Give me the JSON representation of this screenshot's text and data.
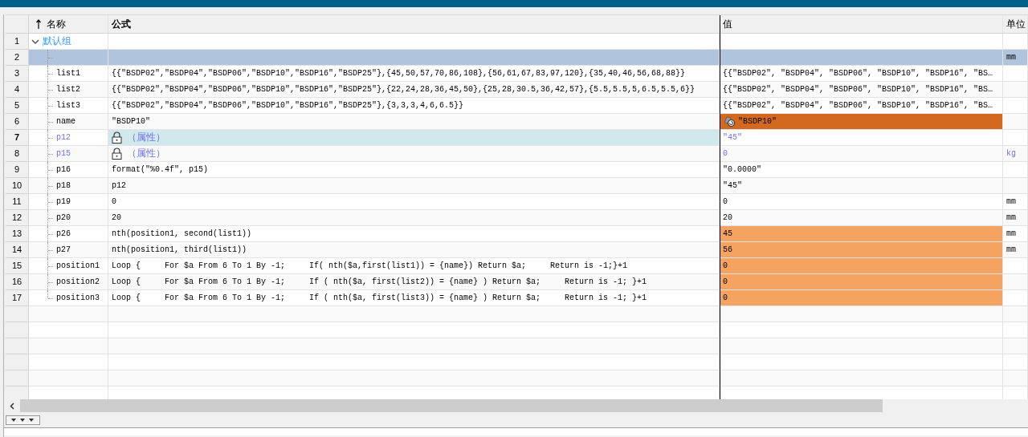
{
  "columns": [
    {
      "label": "名称",
      "sorted": true
    },
    {
      "label": "公式",
      "sorted": false
    },
    {
      "label": "值",
      "sorted": false
    },
    {
      "label": "单位",
      "sorted": false
    }
  ],
  "group": {
    "number": "1",
    "label": "默认组",
    "expanded": true,
    "rows": [
      {
        "number": "2",
        "selected": true,
        "current": false,
        "locked": false,
        "linked": false,
        "unit": "mm"
      },
      {
        "number": "3",
        "name": "list1",
        "formula": "{{\"BSDP02\",\"BSDP04\",\"BSDP06\",\"BSDP10\",\"BSDP16\",\"BSDP25\"},{45,50,57,70,86,108},{56,61,67,83,97,120},{35,40,46,56,68,88}}",
        "value": "{{\"BSDP02\", \"BSDP04\", \"BSDP06\", \"BSDP10\", \"BSDP16\", \"BS…",
        "selected": false,
        "current": false,
        "locked": false,
        "linked": false
      },
      {
        "number": "4",
        "name": "list2",
        "formula": "{{\"BSDP02\",\"BSDP04\",\"BSDP06\",\"BSDP10\",\"BSDP16\",\"BSDP25\"},{22,24,28,36,45,50},{25,28,30.5,36,42,57},{5.5,5.5,5,6.5,5.5,6}}",
        "value": "{{\"BSDP02\", \"BSDP04\", \"BSDP06\", \"BSDP10\", \"BSDP16\", \"BS…",
        "selected": false,
        "current": false,
        "locked": false,
        "linked": false
      },
      {
        "number": "5",
        "name": "list3",
        "formula": "{{\"BSDP02\",\"BSDP04\",\"BSDP06\",\"BSDP10\",\"BSDP16\",\"BSDP25\"},{3,3,3,4,6,6.5}}",
        "value": "{{\"BSDP02\", \"BSDP04\", \"BSDP06\", \"BSDP10\", \"BSDP16\", \"BS…",
        "selected": false,
        "current": false,
        "locked": false,
        "linked": false
      },
      {
        "number": "6",
        "name": "name",
        "formula": "\"BSDP10\"",
        "value": "\"BSDP10\"",
        "color": "#d2691e",
        "selected": false,
        "current": false,
        "locked": false,
        "linked": true
      },
      {
        "number": "7",
        "name": "p12",
        "formula": "（属性）",
        "value": "\"45\"",
        "selected": false,
        "current": true,
        "locked": true,
        "linked": false
      },
      {
        "number": "8",
        "name": "p15",
        "formula": "（属性）",
        "value": "0",
        "unit": "kg",
        "selected": false,
        "current": false,
        "locked": true,
        "linked": false
      },
      {
        "number": "9",
        "name": "p16",
        "formula": "format(\"%0.4f\", p15)",
        "value": "\"0.0000\"",
        "selected": false,
        "current": false,
        "locked": false,
        "linked": false
      },
      {
        "number": "10",
        "name": "p18",
        "formula": "p12",
        "value": "\"45\"",
        "selected": false,
        "current": false,
        "locked": false,
        "linked": false
      },
      {
        "number": "11",
        "name": "p19",
        "formula": "0",
        "value": "0",
        "unit": "mm",
        "selected": false,
        "current": false,
        "locked": false,
        "linked": false
      },
      {
        "number": "12",
        "name": "p20",
        "formula": "20",
        "value": "20",
        "unit": "mm",
        "selected": false,
        "current": false,
        "locked": false,
        "linked": false
      },
      {
        "number": "13",
        "name": "p26",
        "formula": "nth(position1, second(list1))",
        "value": "45",
        "color": "#f4a460",
        "unit": "mm",
        "selected": false,
        "current": false,
        "locked": false,
        "linked": false
      },
      {
        "number": "14",
        "name": "p27",
        "formula": "nth(position1, third(list1))",
        "value": "56",
        "color": "#f4a460",
        "unit": "mm",
        "selected": false,
        "current": false,
        "locked": false,
        "linked": false
      },
      {
        "number": "15",
        "name": "position1",
        "formula": "Loop {     For $a From 6 To 1 By -1;     If( nth($a,first(list1)) = {name}) Return $a;     Return is -1;}+1",
        "value": "0",
        "color": "#f4a460",
        "selected": false,
        "current": false,
        "locked": false,
        "linked": false
      },
      {
        "number": "16",
        "name": "position2",
        "formula": "Loop {     For $a From 6 To 1 By -1;     If ( nth($a, first(list2)) = {name} ) Return $a;     Return is -1; }+1",
        "value": "0",
        "color": "#f4a460",
        "selected": false,
        "current": false,
        "locked": false,
        "linked": false
      },
      {
        "number": "17",
        "name": "position3",
        "formula": "Loop {     For $a From 6 To 1 By -1;     If ( nth($a, first(list3)) = {name} ) Return $a;     Return is -1; }+1",
        "value": "0",
        "color": "#f4a460",
        "selected": false,
        "current": false,
        "locked": false,
        "linked": false
      }
    ]
  }
}
